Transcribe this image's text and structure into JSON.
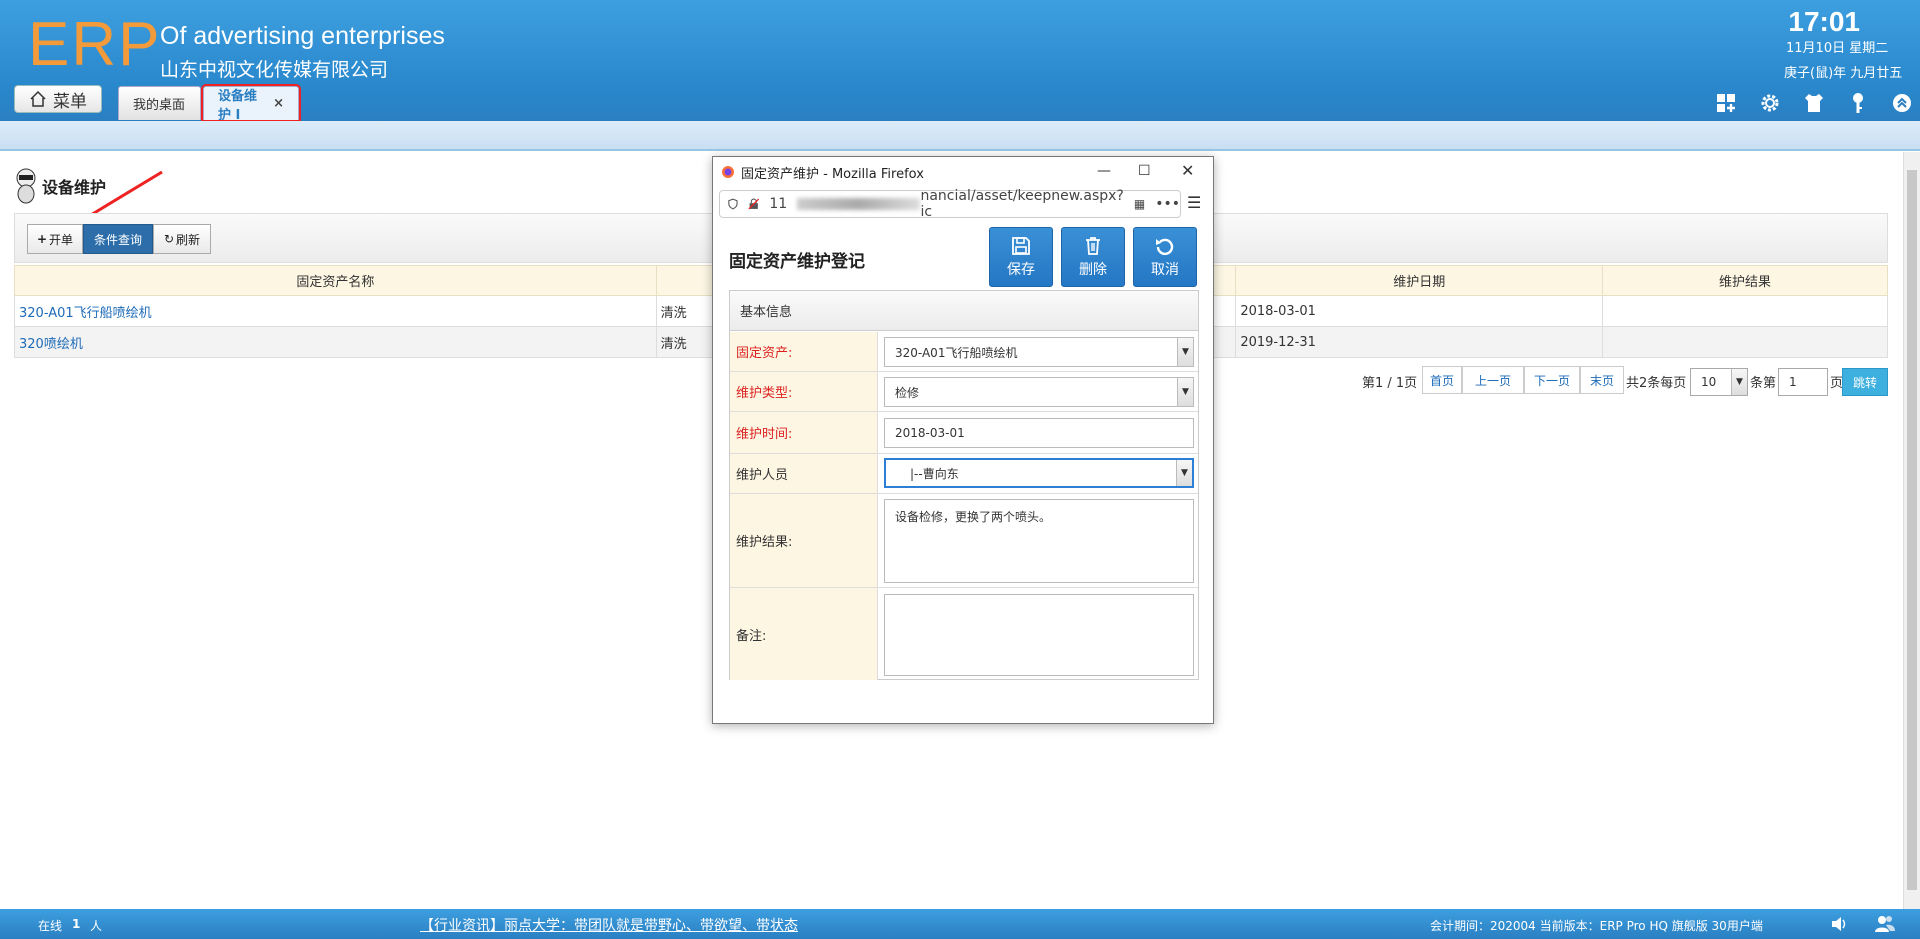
{
  "header": {
    "logo": "ERP",
    "company_en": "Of advertising enterprises",
    "company_cn": "山东中视文化传媒有限公司",
    "menu_label": "菜单",
    "tabs": [
      {
        "label": "我的桌面"
      },
      {
        "label": "设备维护 I",
        "close": "×"
      }
    ],
    "time": "17:01",
    "date": "11月10日 星期二",
    "lunar": "庚子(鼠)年 九月廿五"
  },
  "page": {
    "title": "设备维护",
    "toolbar": {
      "add_label": "开单",
      "query_label": "条件查询",
      "refresh_label": "刷新"
    },
    "table": {
      "headers": [
        "固定资产名称",
        "",
        "维护日期",
        "维护结果"
      ],
      "rows": [
        {
          "name": "320-A01飞行船喷绘机",
          "type": "清洗",
          "date": "2018-03-01",
          "result": ""
        },
        {
          "name": "320喷绘机",
          "type": "清洗",
          "date": "2019-12-31",
          "result": ""
        }
      ]
    },
    "pager": {
      "page_info": "第1 / 1页",
      "first": "首页",
      "prev": "上一页",
      "next": "下一页",
      "last": "末页",
      "total_text": "共2条每页",
      "page_size": "10",
      "per_unit": "条第",
      "page_num": "1",
      "page_unit": "页",
      "go": "跳转"
    }
  },
  "popup": {
    "window_title": "固定资产维护 - Mozilla Firefox",
    "url_prefix": "11",
    "url_visible": "nancial/asset/keepnew.aspx?ic",
    "form_title": "固定资产维护登记",
    "buttons": {
      "save": "保存",
      "delete": "删除",
      "cancel": "取消"
    },
    "section": "基本信息",
    "fields": {
      "asset_label": "固定资产:",
      "asset_value": "320-A01飞行船喷绘机",
      "type_label": "维护类型:",
      "type_value": "检修",
      "time_label": "维护时间:",
      "time_value": "2018-03-01",
      "person_label": "维护人员",
      "person_value": "|--曹向东",
      "result_label": "维护结果:",
      "result_value": "设备检修，更换了两个喷头。",
      "remark_label": "备注:",
      "remark_value": ""
    }
  },
  "footer": {
    "online_label": "在线",
    "online_count": "1",
    "online_unit": "人",
    "news": "【行业资讯】丽点大学：带团队就是带野心、带欲望、带状态",
    "accounting": "会计期间：202004 当前版本：ERP Pro HQ 旗舰版 30用户端"
  },
  "colors": {
    "header_blue": "#2a88cc",
    "logo_orange": "#f39a3b",
    "required_red": "#d22222",
    "button_blue": "#2477c4"
  }
}
